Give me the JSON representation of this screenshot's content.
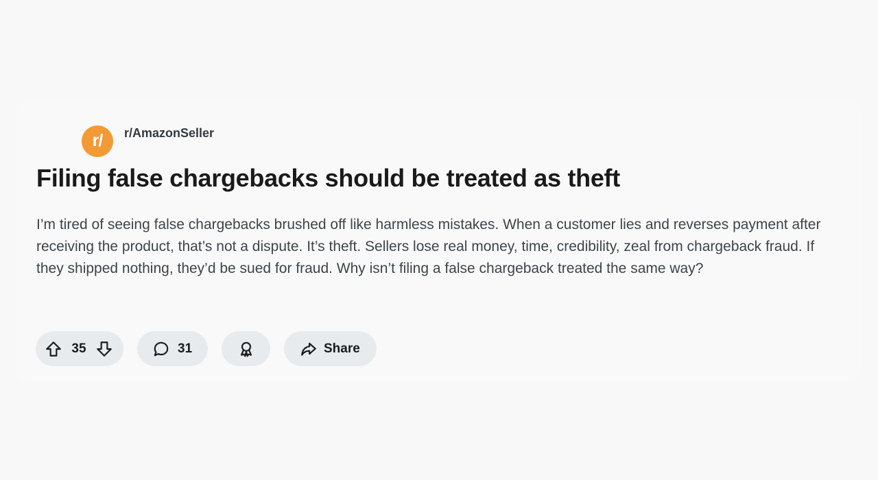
{
  "post": {
    "subreddit": "r/AmazonSeller",
    "avatar_glyph": "r/",
    "title": "Filing false chargebacks should be treated as theft",
    "body": "I’m tired of seeing false chargebacks brushed off like harmless mistakes. When a customer lies and reverses payment after receiving the product, that’s not a dispute. It’s theft. Sellers lose real money, time, credibility, zeal from chargeback fraud. If they shipped nothing, they’d be sued for fraud. Why isn’t filing a false chargeback treated the same way?"
  },
  "actions": {
    "vote_count": "35",
    "comment_count": "31",
    "share_label": "Share"
  },
  "icons": {
    "upvote": "arrow-up-icon",
    "downvote": "arrow-down-icon",
    "comment": "speech-bubble-icon",
    "award": "award-ribbon-icon",
    "share": "share-arrow-icon"
  },
  "colors": {
    "avatar_bg": "#f39a37",
    "pill_bg": "#e8ebed",
    "page_bg": "#f8f8f8"
  }
}
